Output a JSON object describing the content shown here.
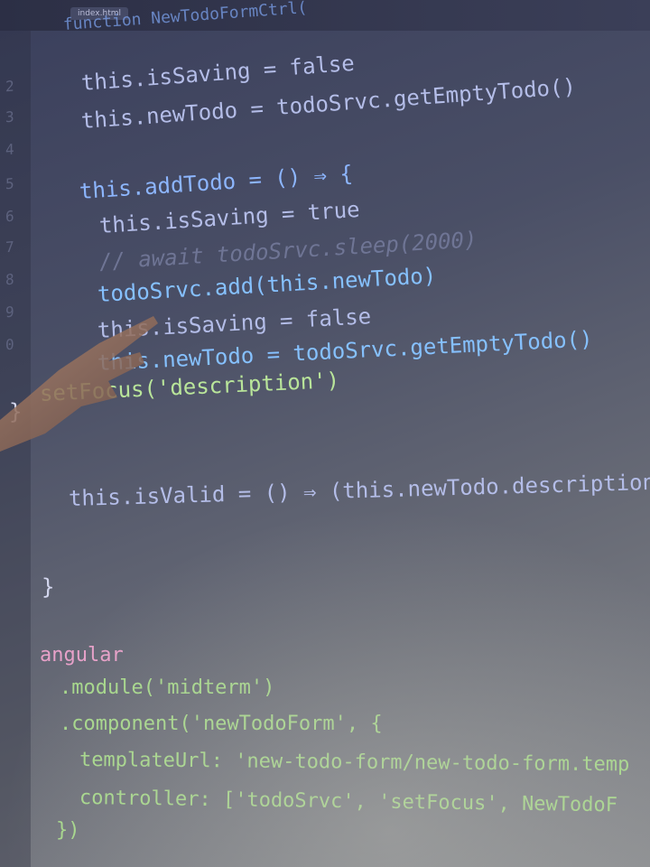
{
  "editor": {
    "tab_label": "index.html",
    "header_fragment": "function NewTodoFormCtrl(",
    "line_numbers": [
      "2",
      "3",
      "4",
      "5",
      "6",
      "7",
      "8",
      "9",
      "0"
    ]
  },
  "code": {
    "l1": "this.isSaving = false",
    "l2": "this.newTodo = todoSrvc.getEmptyTodo()",
    "l3": "this.addTodo = () ⇒ {",
    "l4": "this.isSaving = true",
    "l5": "// await todoSrvc.sleep(2000)",
    "l6": "todoSrvc.add(this.newTodo)",
    "l7": "this.isSaving = false",
    "l8": "this.newTodo = todoSrvc.getEmptyTodo()",
    "l9": "setFocus('description')",
    "l10": "}",
    "l11": "this.isValid = () ⇒ (this.newTodo.description",
    "l12": "}",
    "l13": "angular",
    "l14": ".module('midterm')",
    "l15": ".component('newTodoForm', {",
    "l16": "templateUrl: 'new-todo-form/new-todo-form.temp",
    "l17": "controller: ['todoSrvc', 'setFocus', NewTodoF",
    "l18": "})"
  }
}
